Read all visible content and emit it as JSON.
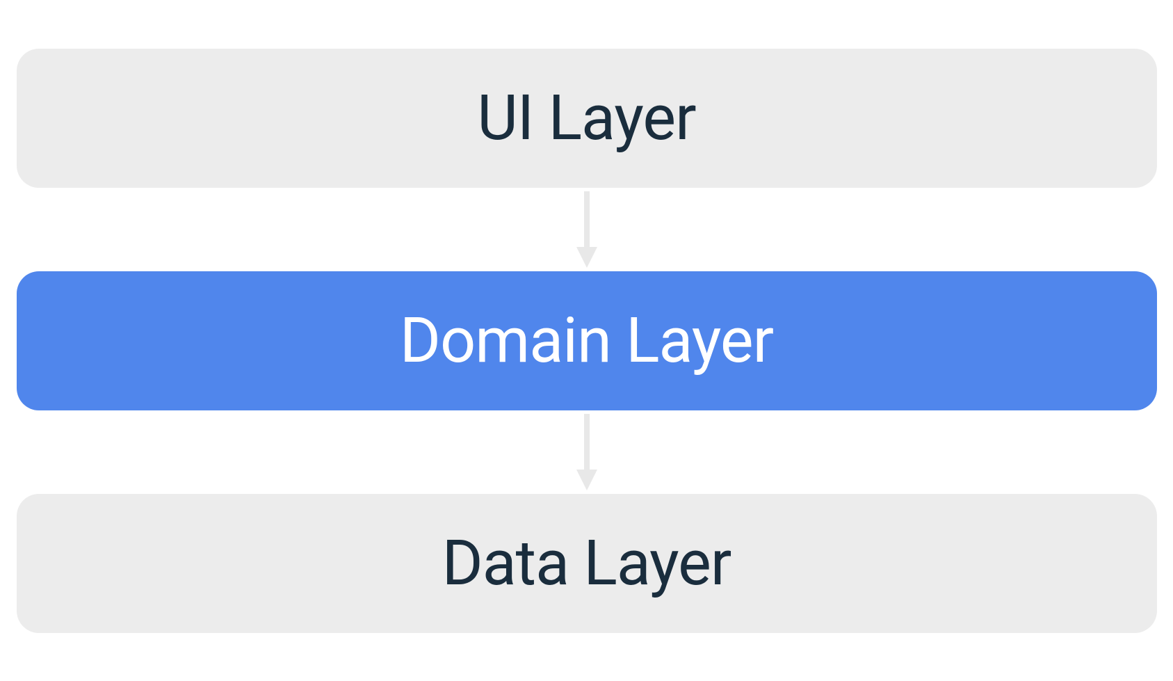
{
  "diagram": {
    "layers": [
      {
        "label": "UI Layer",
        "style": "neutral"
      },
      {
        "label": "Domain Layer",
        "style": "highlighted"
      },
      {
        "label": "Data Layer",
        "style": "neutral"
      }
    ],
    "colors": {
      "neutral_bg": "#ececec",
      "neutral_text": "#1a2d3d",
      "highlighted_bg": "#5086ec",
      "highlighted_text": "#ffffff",
      "arrow": "#e8e8e8"
    }
  }
}
